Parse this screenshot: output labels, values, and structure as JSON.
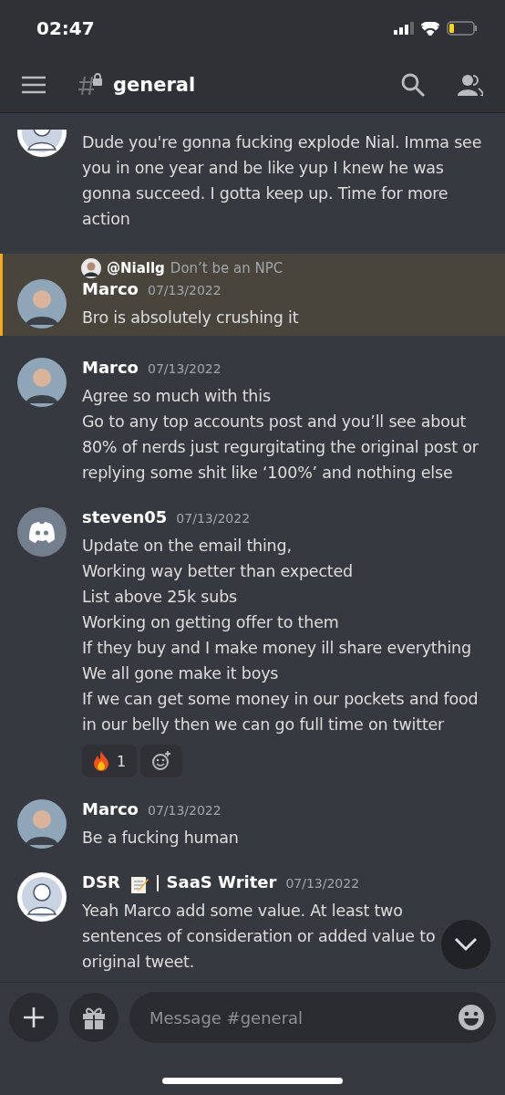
{
  "status_bar": {
    "time": "02:47"
  },
  "header": {
    "channel": "general"
  },
  "messages": [
    {
      "avatar": {
        "kind": "drawing"
      },
      "highlighted": false,
      "lines": [
        "Dude you're gonna fucking explode Nial. Imma see you in one year and be like yup I knew he was gonna succeed. I gotta keep up. Time for more action"
      ]
    },
    {
      "avatar": {
        "kind": "photo"
      },
      "highlighted": true,
      "reply": {
        "user": "@Niallg",
        "text": "Don’t be an NPC"
      },
      "author": "Marco",
      "time": "07/13/2022",
      "lines": [
        "Bro is absolutely crushing it"
      ]
    },
    {
      "avatar": {
        "kind": "photo"
      },
      "highlighted": false,
      "author": "Marco",
      "time": "07/13/2022",
      "lines": [
        "Agree so much with this",
        "Go to any top accounts post and you’ll see about 80% of nerds just regurgitating the original post or replying some shit like ‘100%’ and nothing else"
      ]
    },
    {
      "avatar": {
        "kind": "discord"
      },
      "highlighted": false,
      "author": "steven05",
      "time": "07/13/2022",
      "lines": [
        "Update on the email thing,",
        "Working way better than expected",
        "List above 25k subs",
        "Working on getting offer to them",
        "If they buy and I make money ill share everything",
        "We all gone make it boys",
        "If we can get some money in our pockets and food in our belly then we can go full time on twitter"
      ],
      "reactions": [
        {
          "kind": "fire",
          "count": "1"
        }
      ]
    },
    {
      "avatar": {
        "kind": "photo"
      },
      "highlighted": false,
      "author": "Marco",
      "time": "07/13/2022",
      "lines": [
        "Be a fucking human"
      ]
    },
    {
      "avatar": {
        "kind": "drawing"
      },
      "highlighted": false,
      "author": "DSR",
      "badge": {
        "kind": "memo"
      },
      "author_suffix": "| SaaS Writer",
      "time": "07/13/2022",
      "lines": [
        "Yeah Marco add some value. At least two sentences of consideration or added value to original tweet."
      ]
    }
  ],
  "composer": {
    "placeholder": "Message #general"
  }
}
